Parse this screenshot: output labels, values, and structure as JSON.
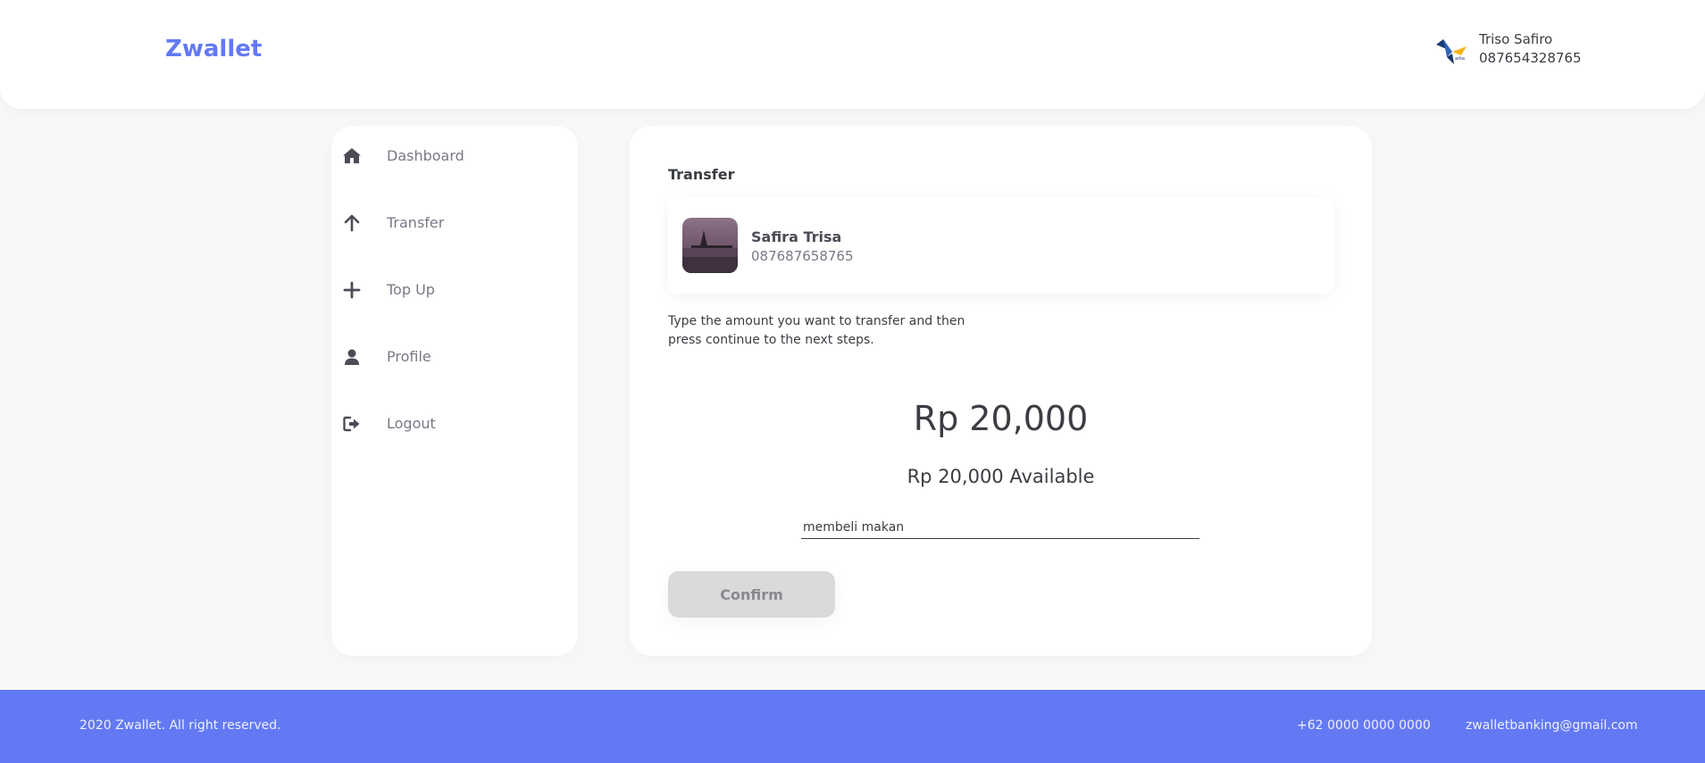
{
  "app": {
    "title": "Zwallet"
  },
  "user": {
    "name": "Triso Safiro",
    "phone": "087654328765"
  },
  "sidebar": {
    "items": [
      {
        "label": "Dashboard",
        "icon": "home-icon"
      },
      {
        "label": "Transfer",
        "icon": "arrow-up-icon"
      },
      {
        "label": "Top Up",
        "icon": "plus-icon"
      },
      {
        "label": "Profile",
        "icon": "user-icon"
      },
      {
        "label": "Logout",
        "icon": "logout-icon"
      }
    ]
  },
  "transfer": {
    "title": "Transfer",
    "recipient": {
      "name": "Safira Trisa",
      "phone": "087687658765"
    },
    "instructions": "Type the amount you want to transfer and then press continue to the next steps.",
    "amount": "Rp 20,000",
    "available": "Rp 20,000 Available",
    "note_value": "membeli makan",
    "confirm_label": "Confirm"
  },
  "footer": {
    "copyright": "2020 Zwallet. All right reserved.",
    "phone": "+62 0000 0000 0000",
    "email": "zwalletbanking@gmail.com"
  },
  "colors": {
    "primary": "#6379f4",
    "text": "#3a3d42",
    "muted": "#7a7886",
    "disabled_button": "#dadada"
  }
}
